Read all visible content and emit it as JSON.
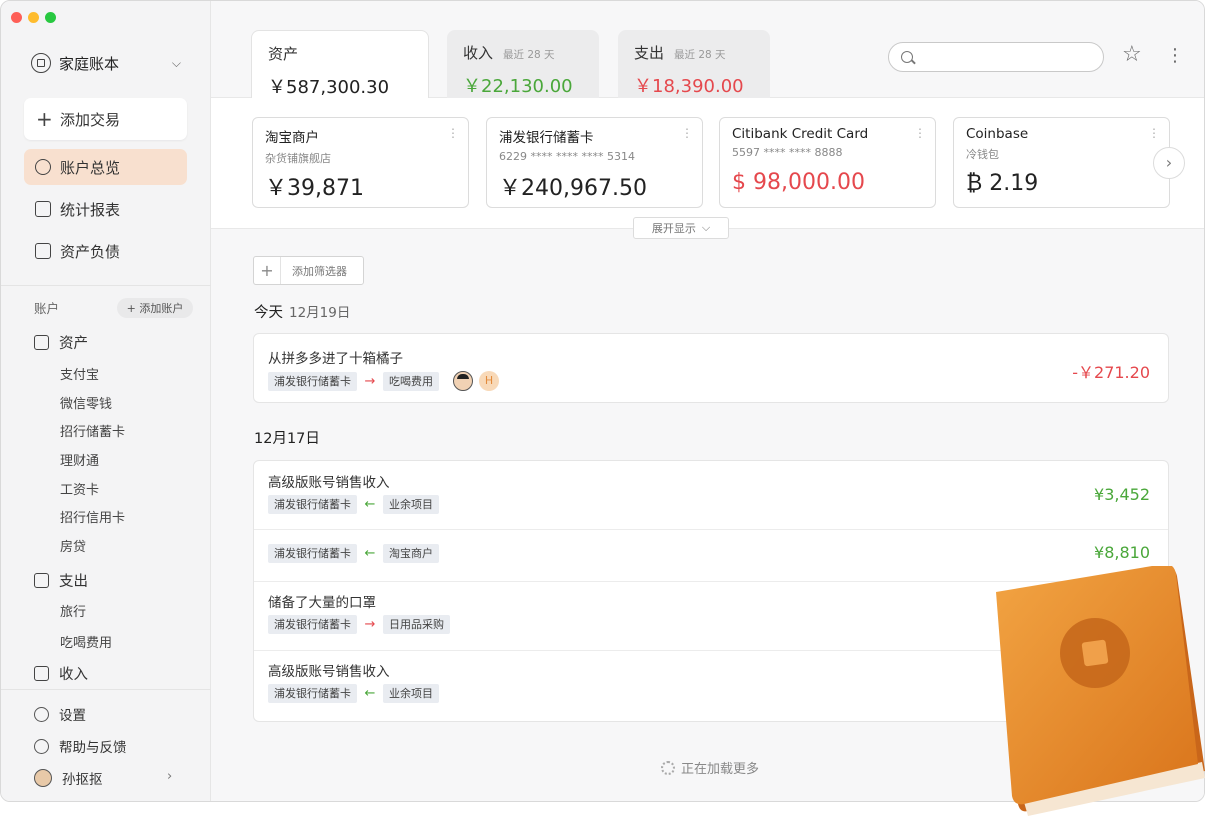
{
  "window": {
    "traffic_lights": [
      "#fe5f57",
      "#febc2e",
      "#28c840"
    ]
  },
  "sidebar": {
    "ledger_name": "家庭账本",
    "add_transaction": "添加交易",
    "nav": [
      {
        "label": "账户总览",
        "icon": "dashboard-icon",
        "active": true
      },
      {
        "label": "统计报表",
        "icon": "chart-icon",
        "active": false
      },
      {
        "label": "资产负债",
        "icon": "balance-sheet-icon",
        "active": false
      }
    ],
    "accounts_heading": "账户",
    "add_account": "+ 添加账户",
    "groups": [
      {
        "label": "资产",
        "icon": "piggy-bank-icon",
        "items": [
          "支付宝",
          "微信零钱",
          "招行储蓄卡",
          "理财通",
          "工资卡",
          "招行信用卡",
          "房贷"
        ]
      },
      {
        "label": "支出",
        "icon": "receipt-icon",
        "items": [
          "旅行",
          "吃喝费用"
        ]
      },
      {
        "label": "收入",
        "icon": "income-icon",
        "items": []
      }
    ],
    "settings": "设置",
    "help": "帮助与反馈",
    "user": "孙抠抠"
  },
  "tabs": [
    {
      "name": "资产",
      "sub": "",
      "value": "￥587,300.30",
      "tone": "neutral"
    },
    {
      "name": "收入",
      "sub": "最近 28 天",
      "value": "￥22,130.00",
      "tone": "green"
    },
    {
      "name": "支出",
      "sub": "最近 28 天",
      "value": "￥18,390.00",
      "tone": "red"
    }
  ],
  "search": {
    "placeholder": ""
  },
  "accounts": [
    {
      "name": "淘宝商户",
      "sub": "杂货铺旗舰店",
      "balance": "￥39,871",
      "tone": "neutral"
    },
    {
      "name": "浦发银行储蓄卡",
      "sub": "6229 **** **** **** 5314",
      "balance": "￥240,967.50",
      "tone": "neutral"
    },
    {
      "name": "Citibank Credit Card",
      "sub": "5597 **** **** 8888",
      "balance": "$ 98,000.00",
      "tone": "red"
    },
    {
      "name": "Coinbase",
      "sub": "冷钱包",
      "balance": "₿ 2.19",
      "tone": "neutral"
    }
  ],
  "expand_label": "展开显示",
  "filter_label": "添加筛选器",
  "days": [
    {
      "label": "今天",
      "date": "12月19日"
    },
    {
      "label": "12月17日",
      "date": ""
    }
  ],
  "transactions_today": [
    {
      "title": "从拼多多进了十箱橘子",
      "from": "浦发银行储蓄卡",
      "to": "吃喝费用",
      "direction": "out",
      "amount": "-￥271.20",
      "avatar_badge": "H"
    }
  ],
  "transactions_dec17": [
    {
      "title": "高级版账号销售收入",
      "from": "浦发银行储蓄卡",
      "to": "业余项目",
      "direction": "in",
      "amount": "¥3,452"
    },
    {
      "title": "",
      "from": "浦发银行储蓄卡",
      "to": "淘宝商户",
      "direction": "in",
      "amount": "¥8,810"
    },
    {
      "title": "储备了大量的口罩",
      "from": "浦发银行储蓄卡",
      "to": "日用品采购",
      "direction": "out",
      "amount": ""
    },
    {
      "title": "高级版账号销售收入",
      "from": "浦发银行储蓄卡",
      "to": "业余项目",
      "direction": "in",
      "amount": ""
    }
  ],
  "loading_text": "正在加载更多",
  "colors": {
    "accent_active": "#f8e0cf",
    "income": "#4aa73a",
    "expense": "#e5484d",
    "book": "#e8922f"
  }
}
